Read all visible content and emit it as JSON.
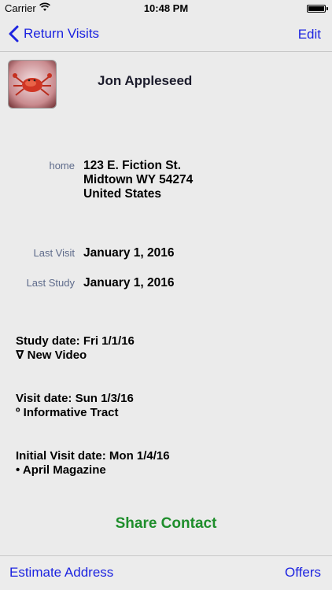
{
  "status_bar": {
    "carrier": "Carrier",
    "time": "10:48 PM"
  },
  "nav": {
    "back_label": "Return Visits",
    "edit_label": "Edit"
  },
  "contact": {
    "name": "Jon Appleseed",
    "address_label": "home",
    "address_line1": "123 E. Fiction St.",
    "address_line2": "Midtown WY 54274",
    "address_line3": "United States",
    "last_visit_label": "Last Visit",
    "last_visit_value": "January 1, 2016",
    "last_study_label": "Last Study",
    "last_study_value": "January 1, 2016"
  },
  "history": [
    {
      "date_line": "Study date:  Fri 1/1/16",
      "item_line": "∇ New Video"
    },
    {
      "date_line": "Visit date:  Sun 1/3/16",
      "item_line": "º Informative Tract"
    },
    {
      "date_line": "Initial Visit date:  Mon 1/4/16",
      "item_line": "• April Magazine"
    }
  ],
  "share_label": "Share Contact",
  "toolbar": {
    "left_label": "Estimate Address",
    "right_label": "Offers"
  },
  "colors": {
    "tint": "#1d24e0",
    "share": "#1f8e2c",
    "label": "#5d6a8a"
  },
  "icons": {
    "back": "chevron-left-icon",
    "wifi": "wifi-icon",
    "battery": "battery-icon"
  }
}
